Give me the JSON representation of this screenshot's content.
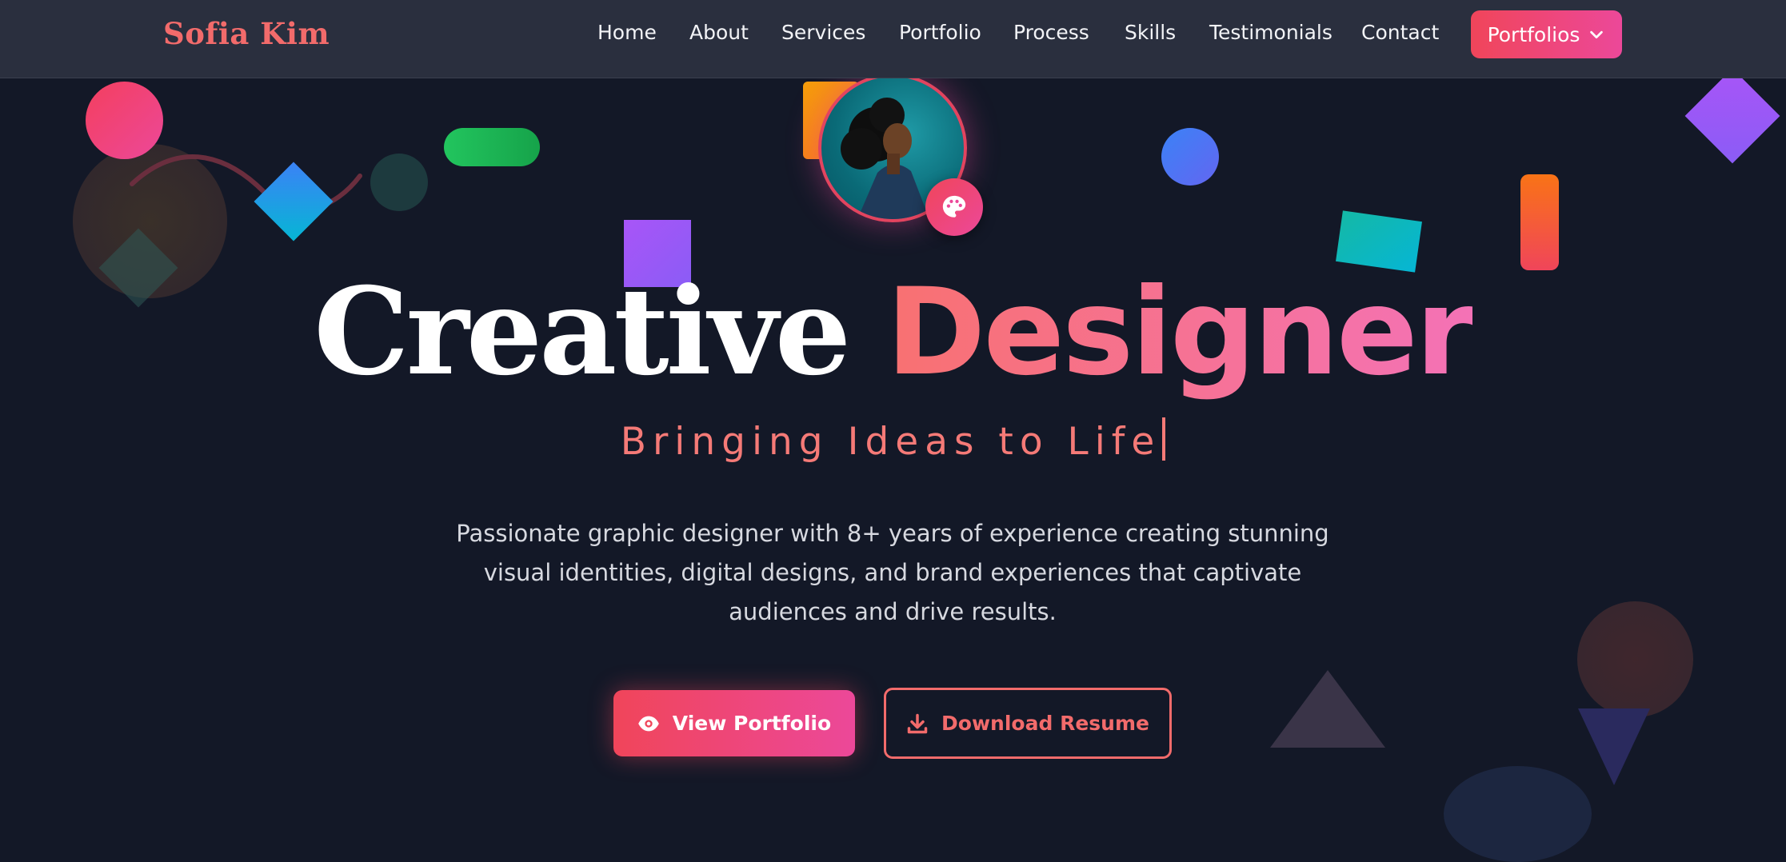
{
  "nav": {
    "brand": "Sofia Kim",
    "links": [
      "Home",
      "About",
      "Services",
      "Portfolio",
      "Process",
      "Skills",
      "Testimonials",
      "Contact"
    ],
    "cta_label": "Portfolios"
  },
  "hero": {
    "headline_word1": "Creative",
    "headline_word2": "Designer",
    "tagline": "Bringing Ideas to Life",
    "description": "Passionate graphic designer with 8+ years of experience creating stunning visual identities, digital designs, and brand experiences that captivate audiences and drive results.",
    "primary_button": "View Portfolio",
    "secondary_button": "Download Resume",
    "badge_icon": "palette-icon",
    "primary_icon": "eye-icon",
    "secondary_icon": "download-icon"
  },
  "colors": {
    "background": "#131827",
    "navbar": "#2a2f3e",
    "accent_start": "#f0455a",
    "accent_end": "#ec4899",
    "tagline": "#f57a77"
  }
}
